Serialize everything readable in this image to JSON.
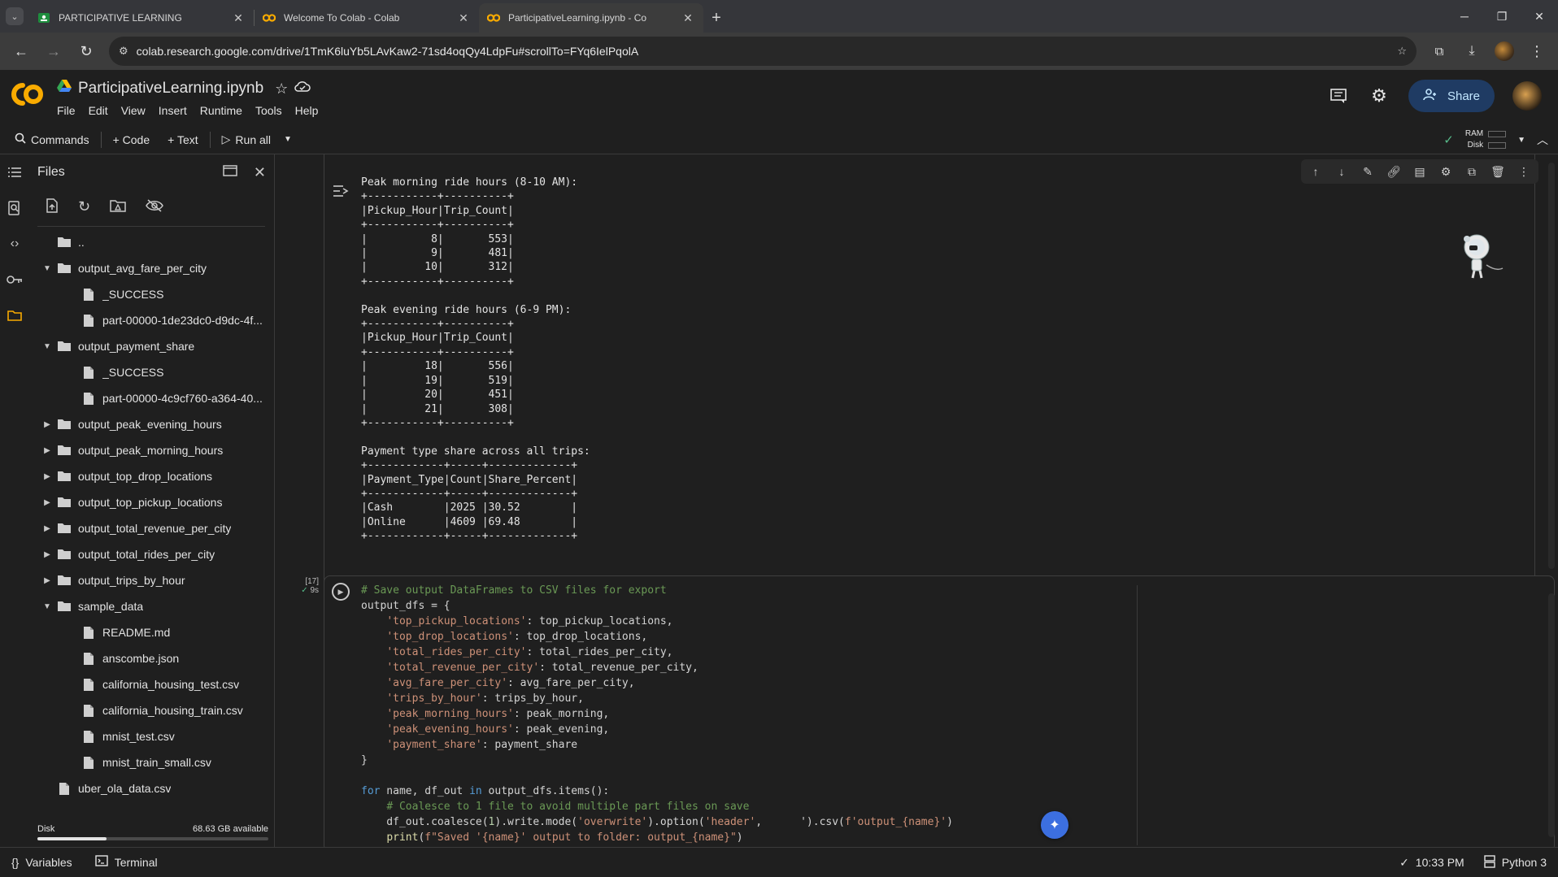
{
  "browser": {
    "tabs": [
      {
        "title": "PARTICIPATIVE LEARNING",
        "icon": "classroom-icon",
        "active": false
      },
      {
        "title": "Welcome To Colab - Colab",
        "icon": "colab-icon",
        "active": false
      },
      {
        "title": "ParticipativeLearning.ipynb - Co",
        "icon": "colab-icon",
        "active": true
      }
    ],
    "url": "colab.research.google.com/drive/1TmK6luYb5LAvKaw2-71sd4oqQy4LdpFu#scrollTo=FYq6IelPqolA"
  },
  "colab": {
    "notebook_title": "ParticipativeLearning.ipynb",
    "menus": [
      "File",
      "Edit",
      "View",
      "Insert",
      "Runtime",
      "Tools",
      "Help"
    ],
    "share_label": "Share",
    "toolbar": {
      "commands": "Commands",
      "code": "+ Code",
      "text": "+ Text",
      "run_all": "Run all",
      "ram": "RAM",
      "disk": "Disk"
    }
  },
  "files_panel": {
    "title": "Files",
    "tree": [
      {
        "name": "..",
        "type": "folder-up",
        "depth": 0,
        "expand": "none"
      },
      {
        "name": "output_avg_fare_per_city",
        "type": "folder",
        "depth": 0,
        "expand": "open"
      },
      {
        "name": "_SUCCESS",
        "type": "file",
        "depth": 1,
        "expand": "none"
      },
      {
        "name": "part-00000-1de23dc0-d9dc-4f...",
        "type": "file",
        "depth": 1,
        "expand": "none"
      },
      {
        "name": "output_payment_share",
        "type": "folder",
        "depth": 0,
        "expand": "open"
      },
      {
        "name": "_SUCCESS",
        "type": "file",
        "depth": 1,
        "expand": "none"
      },
      {
        "name": "part-00000-4c9cf760-a364-40...",
        "type": "file",
        "depth": 1,
        "expand": "none"
      },
      {
        "name": "output_peak_evening_hours",
        "type": "folder",
        "depth": 0,
        "expand": "closed"
      },
      {
        "name": "output_peak_morning_hours",
        "type": "folder",
        "depth": 0,
        "expand": "closed"
      },
      {
        "name": "output_top_drop_locations",
        "type": "folder",
        "depth": 0,
        "expand": "closed"
      },
      {
        "name": "output_top_pickup_locations",
        "type": "folder",
        "depth": 0,
        "expand": "closed"
      },
      {
        "name": "output_total_revenue_per_city",
        "type": "folder",
        "depth": 0,
        "expand": "closed"
      },
      {
        "name": "output_total_rides_per_city",
        "type": "folder",
        "depth": 0,
        "expand": "closed"
      },
      {
        "name": "output_trips_by_hour",
        "type": "folder",
        "depth": 0,
        "expand": "closed"
      },
      {
        "name": "sample_data",
        "type": "folder",
        "depth": 0,
        "expand": "open"
      },
      {
        "name": "README.md",
        "type": "file",
        "depth": 1,
        "expand": "none"
      },
      {
        "name": "anscombe.json",
        "type": "file",
        "depth": 1,
        "expand": "none"
      },
      {
        "name": "california_housing_test.csv",
        "type": "file",
        "depth": 1,
        "expand": "none"
      },
      {
        "name": "california_housing_train.csv",
        "type": "file",
        "depth": 1,
        "expand": "none"
      },
      {
        "name": "mnist_test.csv",
        "type": "file",
        "depth": 1,
        "expand": "none"
      },
      {
        "name": "mnist_train_small.csv",
        "type": "file",
        "depth": 1,
        "expand": "none"
      },
      {
        "name": "uber_ola_data.csv",
        "type": "file",
        "depth": 0,
        "expand": "none"
      }
    ],
    "disk_label": "Disk",
    "disk_available": "68.63 GB available",
    "disk_used_fraction": 0.3
  },
  "output_cell": {
    "text": "Peak morning ride hours (8-10 AM):\n+-----------+----------+\n|Pickup_Hour|Trip_Count|\n+-----------+----------+\n|          8|       553|\n|          9|       481|\n|         10|       312|\n+-----------+----------+\n\nPeak evening ride hours (6-9 PM):\n+-----------+----------+\n|Pickup_Hour|Trip_Count|\n+-----------+----------+\n|         18|       556|\n|         19|       519|\n|         20|       451|\n|         21|       308|\n+-----------+----------+\n\nPayment type share across all trips:\n+------------+-----+-------------+\n|Payment_Type|Count|Share_Percent|\n+------------+-----+-------------+\n|Cash        |2025 |30.52        |\n|Online      |4609 |69.48        |\n+------------+-----+-------------+"
  },
  "code_cell": {
    "index": "[17]",
    "exec_time": "9s",
    "lines": [
      [
        [
          "c",
          "# Save output DataFrames to CSV files for export"
        ]
      ],
      [
        [
          "p",
          "output_dfs = {"
        ]
      ],
      [
        [
          "p",
          "    "
        ],
        [
          "s",
          "'top_pickup_locations'"
        ],
        [
          "p",
          ": top_pickup_locations,"
        ]
      ],
      [
        [
          "p",
          "    "
        ],
        [
          "s",
          "'top_drop_locations'"
        ],
        [
          "p",
          ": top_drop_locations,"
        ]
      ],
      [
        [
          "p",
          "    "
        ],
        [
          "s",
          "'total_rides_per_city'"
        ],
        [
          "p",
          ": total_rides_per_city,"
        ]
      ],
      [
        [
          "p",
          "    "
        ],
        [
          "s",
          "'total_revenue_per_city'"
        ],
        [
          "p",
          ": total_revenue_per_city,"
        ]
      ],
      [
        [
          "p",
          "    "
        ],
        [
          "s",
          "'avg_fare_per_city'"
        ],
        [
          "p",
          ": avg_fare_per_city,"
        ]
      ],
      [
        [
          "p",
          "    "
        ],
        [
          "s",
          "'trips_by_hour'"
        ],
        [
          "p",
          ": trips_by_hour,"
        ]
      ],
      [
        [
          "p",
          "    "
        ],
        [
          "s",
          "'peak_morning_hours'"
        ],
        [
          "p",
          ": peak_morning,"
        ]
      ],
      [
        [
          "p",
          "    "
        ],
        [
          "s",
          "'peak_evening_hours'"
        ],
        [
          "p",
          ": peak_evening,"
        ]
      ],
      [
        [
          "p",
          "    "
        ],
        [
          "s",
          "'payment_share'"
        ],
        [
          "p",
          ": payment_share"
        ]
      ],
      [
        [
          "p",
          "}"
        ]
      ],
      [
        [
          "p",
          ""
        ]
      ],
      [
        [
          "k",
          "for"
        ],
        [
          "p",
          " name, df_out "
        ],
        [
          "k",
          "in"
        ],
        [
          "p",
          " output_dfs.items():"
        ]
      ],
      [
        [
          "p",
          "    "
        ],
        [
          "c",
          "# Coalesce to 1 file to avoid multiple part files on save"
        ]
      ],
      [
        [
          "p",
          "    df_out.coalesce("
        ],
        [
          "n",
          "1"
        ],
        [
          "p",
          ").write.mode("
        ],
        [
          "s",
          "'overwrite'"
        ],
        [
          "p",
          ").option("
        ],
        [
          "s",
          "'header'"
        ],
        [
          "p",
          ",      ').csv("
        ],
        [
          "s",
          "f'output_{name}'"
        ],
        [
          "p",
          ")"
        ]
      ],
      [
        [
          "p",
          "    "
        ],
        [
          "f",
          "print"
        ],
        [
          "p",
          "("
        ],
        [
          "s",
          "f\"Saved '{name}' output to folder: output_{name}\""
        ],
        [
          "p",
          ")"
        ]
      ]
    ]
  },
  "statusbar": {
    "variables": "Variables",
    "terminal": "Terminal",
    "time": "10:33 PM",
    "runtime": "Python 3"
  },
  "colors": {
    "accent_orange": "#f9ab00",
    "share_bg": "#1f3b63",
    "success_green": "#57bb8a"
  }
}
